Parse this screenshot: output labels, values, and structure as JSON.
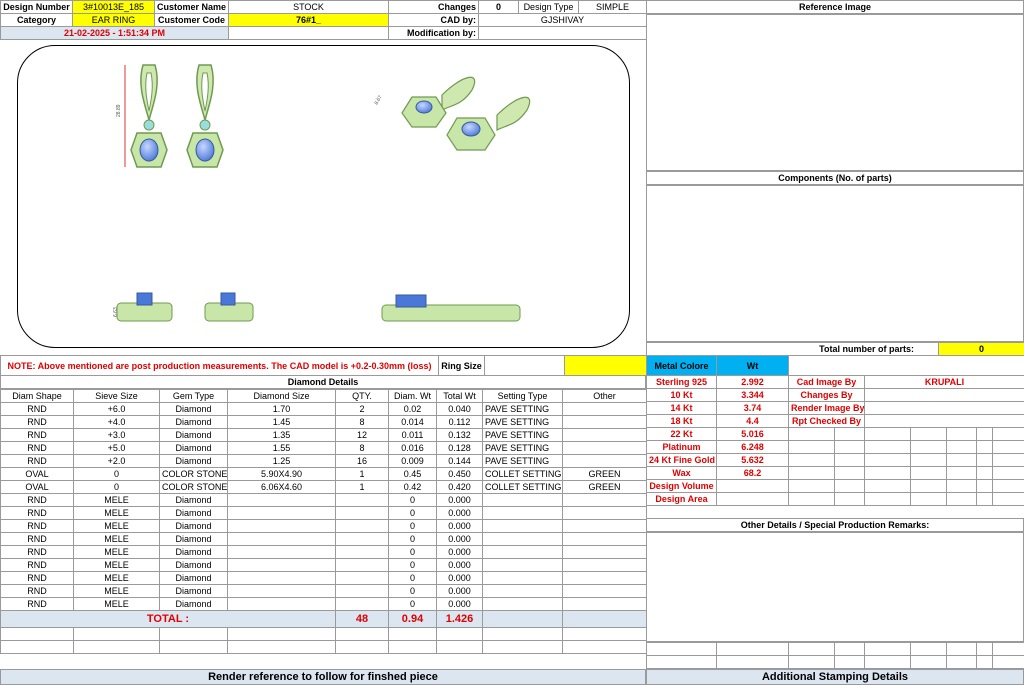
{
  "header": {
    "design_number_label": "Design Number",
    "design_number": "3#10013E_185",
    "customer_name_label": "Customer Name",
    "customer_name": "STOCK",
    "changes_label": "Changes",
    "changes": "0",
    "design_type_label": "Design Type",
    "design_type": "SIMPLE",
    "category_label": "Category",
    "category": "EAR RING",
    "customer_code_label": "Customer Code",
    "customer_code": "76#1_",
    "cad_by_label": "CAD by:",
    "cad_by": "GJSHIVAY",
    "datetime": "21-02-2025 - 1:51:34 PM",
    "modification_by_label": "Modification by:",
    "modification_by": ""
  },
  "right_panel": {
    "reference_image_title": "Reference Image",
    "components_title": "Components (No. of parts)",
    "total_parts_label": "Total number of parts:",
    "total_parts": "0"
  },
  "note": {
    "text": "NOTE: Above mentioned are post production measurements. The CAD model is +0.2-0.30mm (loss)",
    "ring_size_label": "Ring Size",
    "ring_size": ""
  },
  "drawing": {
    "dim_height": "28.89",
    "dim_height_side": "8.67",
    "dim_thickness": "6.63"
  },
  "diamond_details": {
    "title": "Diamond Details",
    "columns": [
      "Diam Shape",
      "Sieve Size",
      "Gem Type",
      "Diamond Size",
      "QTY.",
      "Diam. Wt",
      "Total Wt",
      "Setting Type",
      "Other"
    ],
    "rows": [
      [
        "RND",
        "+6.0",
        "Diamond",
        "1.70",
        "2",
        "0.02",
        "0.040",
        "PAVE SETTING",
        ""
      ],
      [
        "RND",
        "+4.0",
        "Diamond",
        "1.45",
        "8",
        "0.014",
        "0.112",
        "PAVE SETTING",
        ""
      ],
      [
        "RND",
        "+3.0",
        "Diamond",
        "1.35",
        "12",
        "0.011",
        "0.132",
        "PAVE SETTING",
        ""
      ],
      [
        "RND",
        "+5.0",
        "Diamond",
        "1.55",
        "8",
        "0.016",
        "0.128",
        "PAVE SETTING",
        ""
      ],
      [
        "RND",
        "+2.0",
        "Diamond",
        "1.25",
        "16",
        "0.009",
        "0.144",
        "PAVE SETTING",
        ""
      ],
      [
        "OVAL",
        "0",
        "COLOR STONE",
        "5.90X4.90",
        "1",
        "0.45",
        "0.450",
        "COLLET SETTING",
        "GREEN"
      ],
      [
        "OVAL",
        "0",
        "COLOR STONE",
        "6.06X4.60",
        "1",
        "0.42",
        "0.420",
        "COLLET SETTING",
        "GREEN"
      ],
      [
        "RND",
        "MELE",
        "Diamond",
        "",
        "",
        "0",
        "0.000",
        "",
        ""
      ],
      [
        "RND",
        "MELE",
        "Diamond",
        "",
        "",
        "0",
        "0.000",
        "",
        ""
      ],
      [
        "RND",
        "MELE",
        "Diamond",
        "",
        "",
        "0",
        "0.000",
        "",
        ""
      ],
      [
        "RND",
        "MELE",
        "Diamond",
        "",
        "",
        "0",
        "0.000",
        "",
        ""
      ],
      [
        "RND",
        "MELE",
        "Diamond",
        "",
        "",
        "0",
        "0.000",
        "",
        ""
      ],
      [
        "RND",
        "MELE",
        "Diamond",
        "",
        "",
        "0",
        "0.000",
        "",
        ""
      ],
      [
        "RND",
        "MELE",
        "Diamond",
        "",
        "",
        "0",
        "0.000",
        "",
        ""
      ],
      [
        "RND",
        "MELE",
        "Diamond",
        "",
        "",
        "0",
        "0.000",
        "",
        ""
      ],
      [
        "RND",
        "MELE",
        "Diamond",
        "",
        "",
        "0",
        "0.000",
        "",
        ""
      ]
    ],
    "total_label": "TOTAL :",
    "total_qty": "48",
    "total_diam_wt": "0.94",
    "total_wt": "1.426"
  },
  "metal": {
    "metal_colore_label": "Metal Colore",
    "wt_label": "Wt",
    "rows": [
      [
        "Sterling 925",
        "2.992"
      ],
      [
        "10 Kt",
        "3.344"
      ],
      [
        "14 Kt",
        "3.74"
      ],
      [
        "18 Kt",
        "4.4"
      ],
      [
        "22 Kt",
        "5.016"
      ],
      [
        "Platinum",
        "6.248"
      ],
      [
        "24 Kt Fine Gold",
        "5.632"
      ],
      [
        "Wax",
        "68.2"
      ],
      [
        "Design Volume",
        ""
      ],
      [
        "Design Area",
        ""
      ]
    ]
  },
  "roles": [
    [
      "Cad Image By",
      "KRUPALI"
    ],
    [
      "Changes By",
      ""
    ],
    [
      "Render Image By",
      ""
    ],
    [
      "Rpt Checked By",
      ""
    ]
  ],
  "other_details_title": "Other Details / Special Production Remarks:",
  "footer": {
    "render_reference": "Render reference to follow for finshed piece",
    "additional_stamping": "Additional Stamping Details"
  }
}
